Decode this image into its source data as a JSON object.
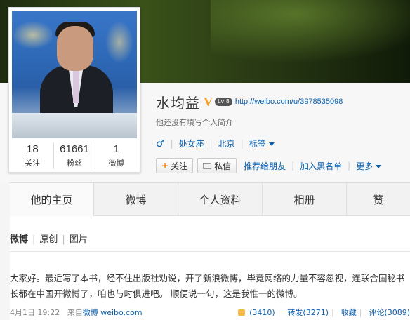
{
  "profile": {
    "name": "水均益",
    "verified_mark": "V",
    "level": "Lv 8",
    "url": "http://weibo.com/u/3978535098",
    "bio": "他还没有填写个人简介",
    "gender_icon": "♂",
    "zodiac": "处女座",
    "location": "北京",
    "tags_label": "标签"
  },
  "stats": [
    {
      "num": "18",
      "label": "关注"
    },
    {
      "num": "61661",
      "label": "粉丝"
    },
    {
      "num": "1",
      "label": "微博"
    }
  ],
  "actions": {
    "follow": "关注",
    "message": "私信",
    "recommend": "推荐给朋友",
    "blacklist": "加入黑名单",
    "more": "更多"
  },
  "tabs": [
    "他的主页",
    "微博",
    "个人资料",
    "相册",
    "赞"
  ],
  "feed": {
    "subnav": [
      "微博",
      "原创",
      "图片"
    ],
    "post_text": "大家好。最近写了本书，经不住出版社劝说，开了新浪微博，毕竟网络的力量不容忽视，连联合国秘书长都在中国开微博了，咱也与时俱进吧。 顺便说一句，这是我惟一的微博。",
    "date": "4月1日 19:22",
    "source_prefix": "来自",
    "source": "微博 weibo.com",
    "likes": "(3410)",
    "repost": "转发(3271)",
    "favorite": "收藏",
    "comment": "评论(3089)"
  }
}
